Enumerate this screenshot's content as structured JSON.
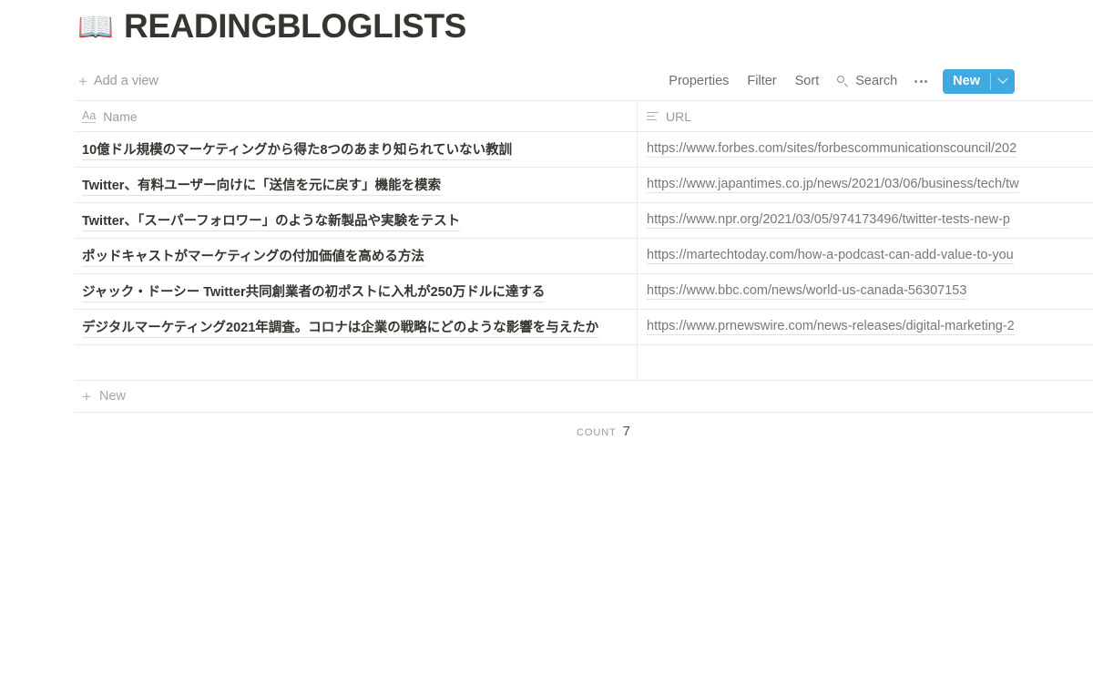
{
  "page": {
    "emoji": "📖",
    "emoji_name": "open-book-emoji",
    "title": "READINGBLOGLISTS"
  },
  "toolbar": {
    "add_view_label": "Add a view",
    "properties_label": "Properties",
    "filter_label": "Filter",
    "sort_label": "Sort",
    "search_label": "Search",
    "more_options_label": "•••",
    "new_label": "New",
    "accent_color": "#3fa9e0"
  },
  "table": {
    "columns": [
      {
        "label": "Name",
        "icon": "text-type-icon"
      },
      {
        "label": "URL",
        "icon": "text-lines-icon"
      }
    ],
    "rows": [
      {
        "name": "10億ドル規模のマーケティングから得た8つのあまり知られていない教訓",
        "url": "https://www.forbes.com/sites/forbescommunicationscouncil/202"
      },
      {
        "name": "Twitter、有料ユーザー向けに「送信を元に戻す」機能を模索",
        "url": "https://www.japantimes.co.jp/news/2021/03/06/business/tech/tw"
      },
      {
        "name": "Twitter、「スーパーフォロワー」のような新製品や実験をテスト",
        "url": "https://www.npr.org/2021/03/05/974173496/twitter-tests-new-p"
      },
      {
        "name": "ポッドキャストがマーケティングの付加価値を高める方法",
        "url": "https://martechtoday.com/how-a-podcast-can-add-value-to-you"
      },
      {
        "name": "ジャック・ドーシー Twitter共同創業者の初ポストに入札が250万ドルに達する",
        "url": "https://www.bbc.com/news/world-us-canada-56307153"
      },
      {
        "name": "デジタルマーケティング2021年調査。コロナは企業の戦略にどのような影響を与えたか",
        "url": "https://www.prnewswire.com/news-releases/digital-marketing-2"
      },
      {
        "name": "",
        "url": ""
      }
    ],
    "new_row_label": "New",
    "count_label": "Count",
    "count_value": "7"
  }
}
